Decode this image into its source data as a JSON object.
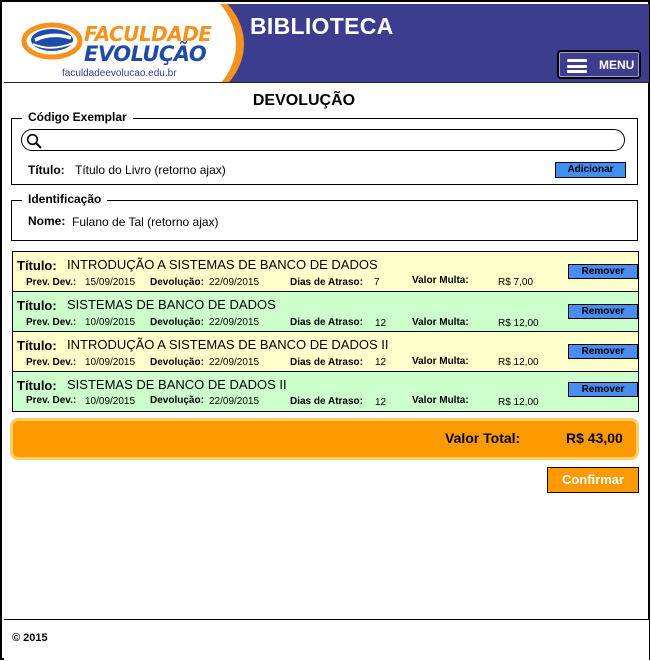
{
  "header": {
    "logo": {
      "line1": "FACULDADE",
      "line2": "EVOLUÇÃO",
      "url": "faculdadeevolucao.edu.br"
    },
    "title": "BIBLIOTECA",
    "menu_label": "MENU"
  },
  "page_title": "DEVOLUÇÃO",
  "codigo": {
    "legend": "Código Exemplar",
    "search_value": "",
    "titulo_label": "Título:",
    "titulo_value": "Título do Livro (retorno ajax)",
    "add_label": "Adicionar"
  },
  "identificacao": {
    "legend": "Identificação",
    "nome_label": "Nome:",
    "nome_value": "Fulano de Tal (retorno ajax)"
  },
  "items": [
    {
      "titulo_label": "Título:",
      "titulo": "INTRODUÇÃO A SISTEMAS DE BANCO DE DADOS",
      "prev_label": "Prev. Dev.:",
      "prev": "15/09/2015",
      "dev_label": "Devolução:",
      "dev": "22/09/2015",
      "atraso_label": "Dias de Atraso:",
      "atraso": "7",
      "multa_label": "Valor Multa:",
      "multa": "R$ 7,00",
      "remove_label": "Remover",
      "color": "#ffffcc"
    },
    {
      "titulo_label": "Título:",
      "titulo": "SISTEMAS DE BANCO DE DADOS",
      "prev_label": "Prev. Dev.:",
      "prev": "10/09/2015",
      "dev_label": "Devolução:",
      "dev": "22/09/2015",
      "atraso_label": "Dias de Atraso:",
      "atraso": "12",
      "multa_label": "Valor Multa:",
      "multa": "R$ 12,00",
      "remove_label": "Remover",
      "color": "#ccffcc"
    },
    {
      "titulo_label": "Título:",
      "titulo": "INTRODUÇÃO A SISTEMAS DE BANCO DE DADOS II",
      "prev_label": "Prev. Dev.:",
      "prev": "10/09/2015",
      "dev_label": "Devolução:",
      "dev": "22/09/2015",
      "atraso_label": "Dias de Atraso:",
      "atraso": "12",
      "multa_label": "Valor Multa:",
      "multa": "R$ 12,00",
      "remove_label": "Remover",
      "color": "#ffffcc"
    },
    {
      "titulo_label": "Título:",
      "titulo": "SISTEMAS DE BANCO DE DADOS II",
      "prev_label": "Prev. Dev.:",
      "prev": "10/09/2015",
      "dev_label": "Devolução:",
      "dev": "22/09/2015",
      "atraso_label": "Dias de Atraso:",
      "atraso": "12",
      "multa_label": "Valor Multa:",
      "multa": "R$ 12,00",
      "remove_label": "Remover",
      "color": "#ccffcc"
    }
  ],
  "total": {
    "label": "Valor Total:",
    "value": "R$ 43,00"
  },
  "confirm_label": "Confirmar",
  "footer": {
    "copyright": "© 2015"
  },
  "colors": {
    "header_bg": "#3d3d8f",
    "accent_orange": "#ff9900",
    "button_blue": "#4a8df0"
  },
  "icons": {
    "menu": "hamburger-icon",
    "search": "search-icon",
    "logo": "logo-swoosh-icon"
  }
}
